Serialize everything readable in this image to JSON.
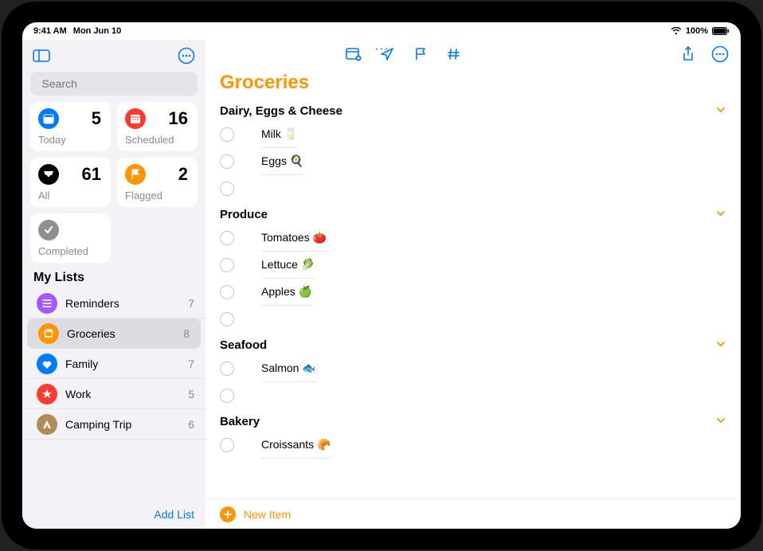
{
  "statusbar": {
    "time": "9:41 AM",
    "date": "Mon Jun 10",
    "battery": "100%"
  },
  "sidebar": {
    "search_placeholder": "Search",
    "categories": {
      "today": {
        "label": "Today",
        "count": "5"
      },
      "scheduled": {
        "label": "Scheduled",
        "count": "16"
      },
      "all": {
        "label": "All",
        "count": "61"
      },
      "flagged": {
        "label": "Flagged",
        "count": "2"
      },
      "completed": {
        "label": "Completed"
      }
    },
    "mylists_header": "My Lists",
    "lists": [
      {
        "label": "Reminders",
        "count": "7",
        "color": "#a259ff"
      },
      {
        "label": "Groceries",
        "count": "8",
        "color": "#ff9500",
        "selected": true
      },
      {
        "label": "Family",
        "count": "7",
        "color": "#007aff"
      },
      {
        "label": "Work",
        "count": "5",
        "color": "#ff3b30"
      },
      {
        "label": "Camping Trip",
        "count": "6",
        "color": "#b08b57"
      }
    ],
    "add_list_label": "Add List"
  },
  "main": {
    "title": "Groceries",
    "sections": [
      {
        "title": "Dairy, Eggs & Cheese",
        "items": [
          "Milk 🥛",
          "Eggs 🍳",
          ""
        ]
      },
      {
        "title": "Produce",
        "items": [
          "Tomatoes 🍅",
          "Lettuce 🥬",
          "Apples 🍏",
          ""
        ]
      },
      {
        "title": "Seafood",
        "items": [
          "Salmon 🐟",
          ""
        ]
      },
      {
        "title": "Bakery",
        "items": [
          "Croissants 🥐"
        ]
      }
    ],
    "new_item_label": "New Item"
  }
}
